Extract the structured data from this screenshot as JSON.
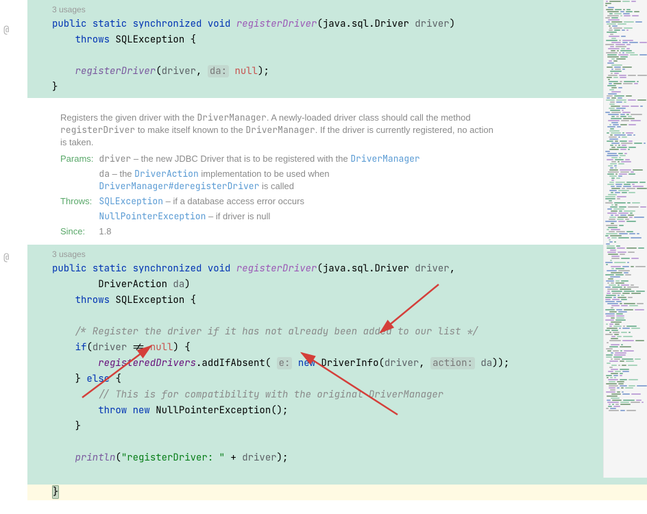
{
  "block1": {
    "usages": "3 usages",
    "line1": {
      "public": "public",
      "static": "static",
      "synchronized": "synchronized",
      "void": "void",
      "method": "registerDriver",
      "paramType": "java.sql.Driver",
      "paramName": "driver"
    },
    "line2": {
      "throws": "throws",
      "exception": "SQLException"
    },
    "line3": {
      "call": "registerDriver",
      "arg1": "driver",
      "hint": "da:",
      "null": "null"
    }
  },
  "javadoc": {
    "desc_pre": "Registers the given driver with the ",
    "desc_dm": "DriverManager",
    "desc_mid1": ". A newly-loaded driver class should call the method ",
    "desc_rd": "registerDriver",
    "desc_mid2": " to make itself known to the ",
    "desc_dm2": "DriverManager",
    "desc_end": ". If the driver is currently registered, no action is taken.",
    "params_label": "Params:",
    "param_driver": "driver",
    "param_driver_txt": " – the new JDBC Driver that is to be registered with the ",
    "param_driver_link": "DriverManager",
    "param_da": "da",
    "param_da_txt": " – the ",
    "param_da_link": "DriverAction",
    "param_da_txt2": " implementation to be used when ",
    "param_da_link2": "DriverManager#deregisterDriver",
    "param_da_txt3": " is called",
    "throws_label": "Throws:",
    "throws_sql": "SQLException",
    "throws_sql_txt": " – if a database access error occurs",
    "throws_npe": "NullPointerException",
    "throws_npe_txt": " – if driver is null",
    "since_label": "Since:",
    "since_val": "1.8"
  },
  "block2": {
    "usages": "3 usages",
    "line1": {
      "public": "public",
      "static": "static",
      "synchronized": "synchronized",
      "void": "void",
      "method": "registerDriver",
      "paramType": "java.sql.Driver",
      "paramName": "driver"
    },
    "line1b": {
      "type": "DriverAction",
      "param": "da"
    },
    "line2": {
      "throws": "throws",
      "exception": "SQLException"
    },
    "comment1": "/* Register the driver if it has not already been added to our list */",
    "line_if": {
      "if": "if",
      "var": "driver",
      "null": "null"
    },
    "line_reg": {
      "field": "registeredDrivers",
      "method": "addIfAbsent",
      "hint1": "e:",
      "new": "new",
      "type": "DriverInfo",
      "arg1": "driver",
      "hint2": "action:",
      "arg2": "da"
    },
    "line_else": {
      "else": "else"
    },
    "comment2": "// This is for compatibility with the original DriverManager",
    "line_throw": {
      "throw": "throw",
      "new": "new",
      "type": "NullPointerException"
    },
    "line_println": {
      "method": "println",
      "string": "\"registerDriver: \"",
      "plus": " + ",
      "var": "driver"
    }
  }
}
